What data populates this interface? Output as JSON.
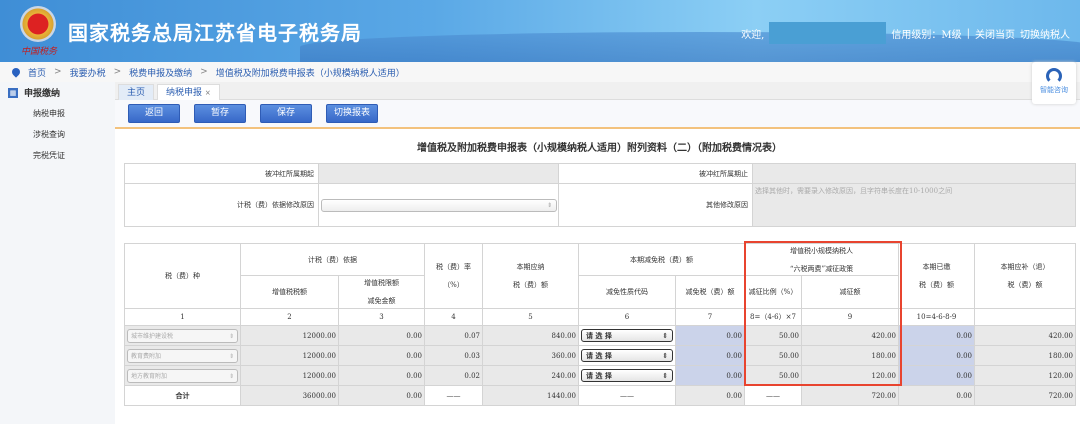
{
  "header": {
    "title": "国家税务总局江苏省电子税务局",
    "emblem_text": "中国税务",
    "welcome": "欢迎,",
    "credit": "信用级别：M级",
    "sep": "|",
    "close_page": "关闭当页",
    "switch_taxpayer": "切换纳税人"
  },
  "breadcrumb": [
    "首页",
    "我要办税",
    "税费申报及缴纳",
    "增值税及附加税费申报表（小规模纳税人适用）"
  ],
  "breadcrumb_sep": ">",
  "sidebar": {
    "section": "申报缴纳",
    "items": [
      "纳税申报",
      "涉税查询",
      "完税凭证"
    ]
  },
  "tabs": [
    {
      "label": "主页"
    },
    {
      "label": "纳税申报",
      "close": "×"
    }
  ],
  "toolbar": {
    "back": "返回",
    "temp_save": "暂存",
    "save": "保存",
    "switch_report": "切换报表"
  },
  "consult": "智能咨询",
  "page_title": "增值税及附加税费申报表（小规模纳税人适用）附列资料（二）（附加税费情况表）",
  "form": {
    "period_start": "被冲红所属期起",
    "period_end": "被冲红所属期止",
    "basis_reason": "计税（费）依据修改原因",
    "other_reason": "其他修改原因",
    "other_placeholder": "选择其他时，需要录入修改原因，且字符串长度在10-1000之间"
  },
  "table": {
    "h_type": "税（费）种",
    "h_basis": "计税（费）依据",
    "h_vat": "增值税税额",
    "h_limit1": "增值税限额",
    "h_limit2": "减免金额",
    "h_rate1": "税（费）率",
    "h_rate2": "（%）",
    "h_due1": "本期应纳",
    "h_due2": "税（费）额",
    "h_relief": "本期减免税（费）额",
    "h_code": "减免性质代码",
    "h_relief_amt": "减免税（费）额",
    "h_policy1": "增值税小规模纳税人",
    "h_policy2": "“六税两费”减征政策",
    "h_ratio": "减征比例（%）",
    "h_reduce": "减征额",
    "h_paid1": "本期已缴",
    "h_paid2": "税（费）额",
    "h_refund1": "本期应补（退）",
    "h_refund2": "税（费）额",
    "col_nums": [
      "1",
      "2",
      "3",
      "4",
      "5",
      "6",
      "7",
      "8=（4-6）×7",
      "9",
      "10=4-6-8-9"
    ],
    "select_placeholder": "请 选 择",
    "rows": [
      {
        "type": "城市维护建设税",
        "vat": "12000.00",
        "limit": "0.00",
        "rate": "0.07",
        "due": "840.00",
        "relief": "0.00",
        "ratio": "50.00",
        "reduce": "420.00",
        "paid": "0.00",
        "refund": "420.00"
      },
      {
        "type": "教育费附加",
        "vat": "12000.00",
        "limit": "0.00",
        "rate": "0.03",
        "due": "360.00",
        "relief": "0.00",
        "ratio": "50.00",
        "reduce": "180.00",
        "paid": "0.00",
        "refund": "180.00"
      },
      {
        "type": "地方教育附加",
        "vat": "12000.00",
        "limit": "0.00",
        "rate": "0.02",
        "due": "240.00",
        "relief": "0.00",
        "ratio": "50.00",
        "reduce": "120.00",
        "paid": "0.00",
        "refund": "120.00"
      }
    ],
    "total": {
      "label": "合计",
      "vat": "36000.00",
      "limit": "0.00",
      "rate": "——",
      "due": "1440.00",
      "code": "——",
      "relief": "0.00",
      "ratio": "——",
      "reduce": "720.00",
      "paid": "0.00",
      "refund": "720.00"
    }
  }
}
